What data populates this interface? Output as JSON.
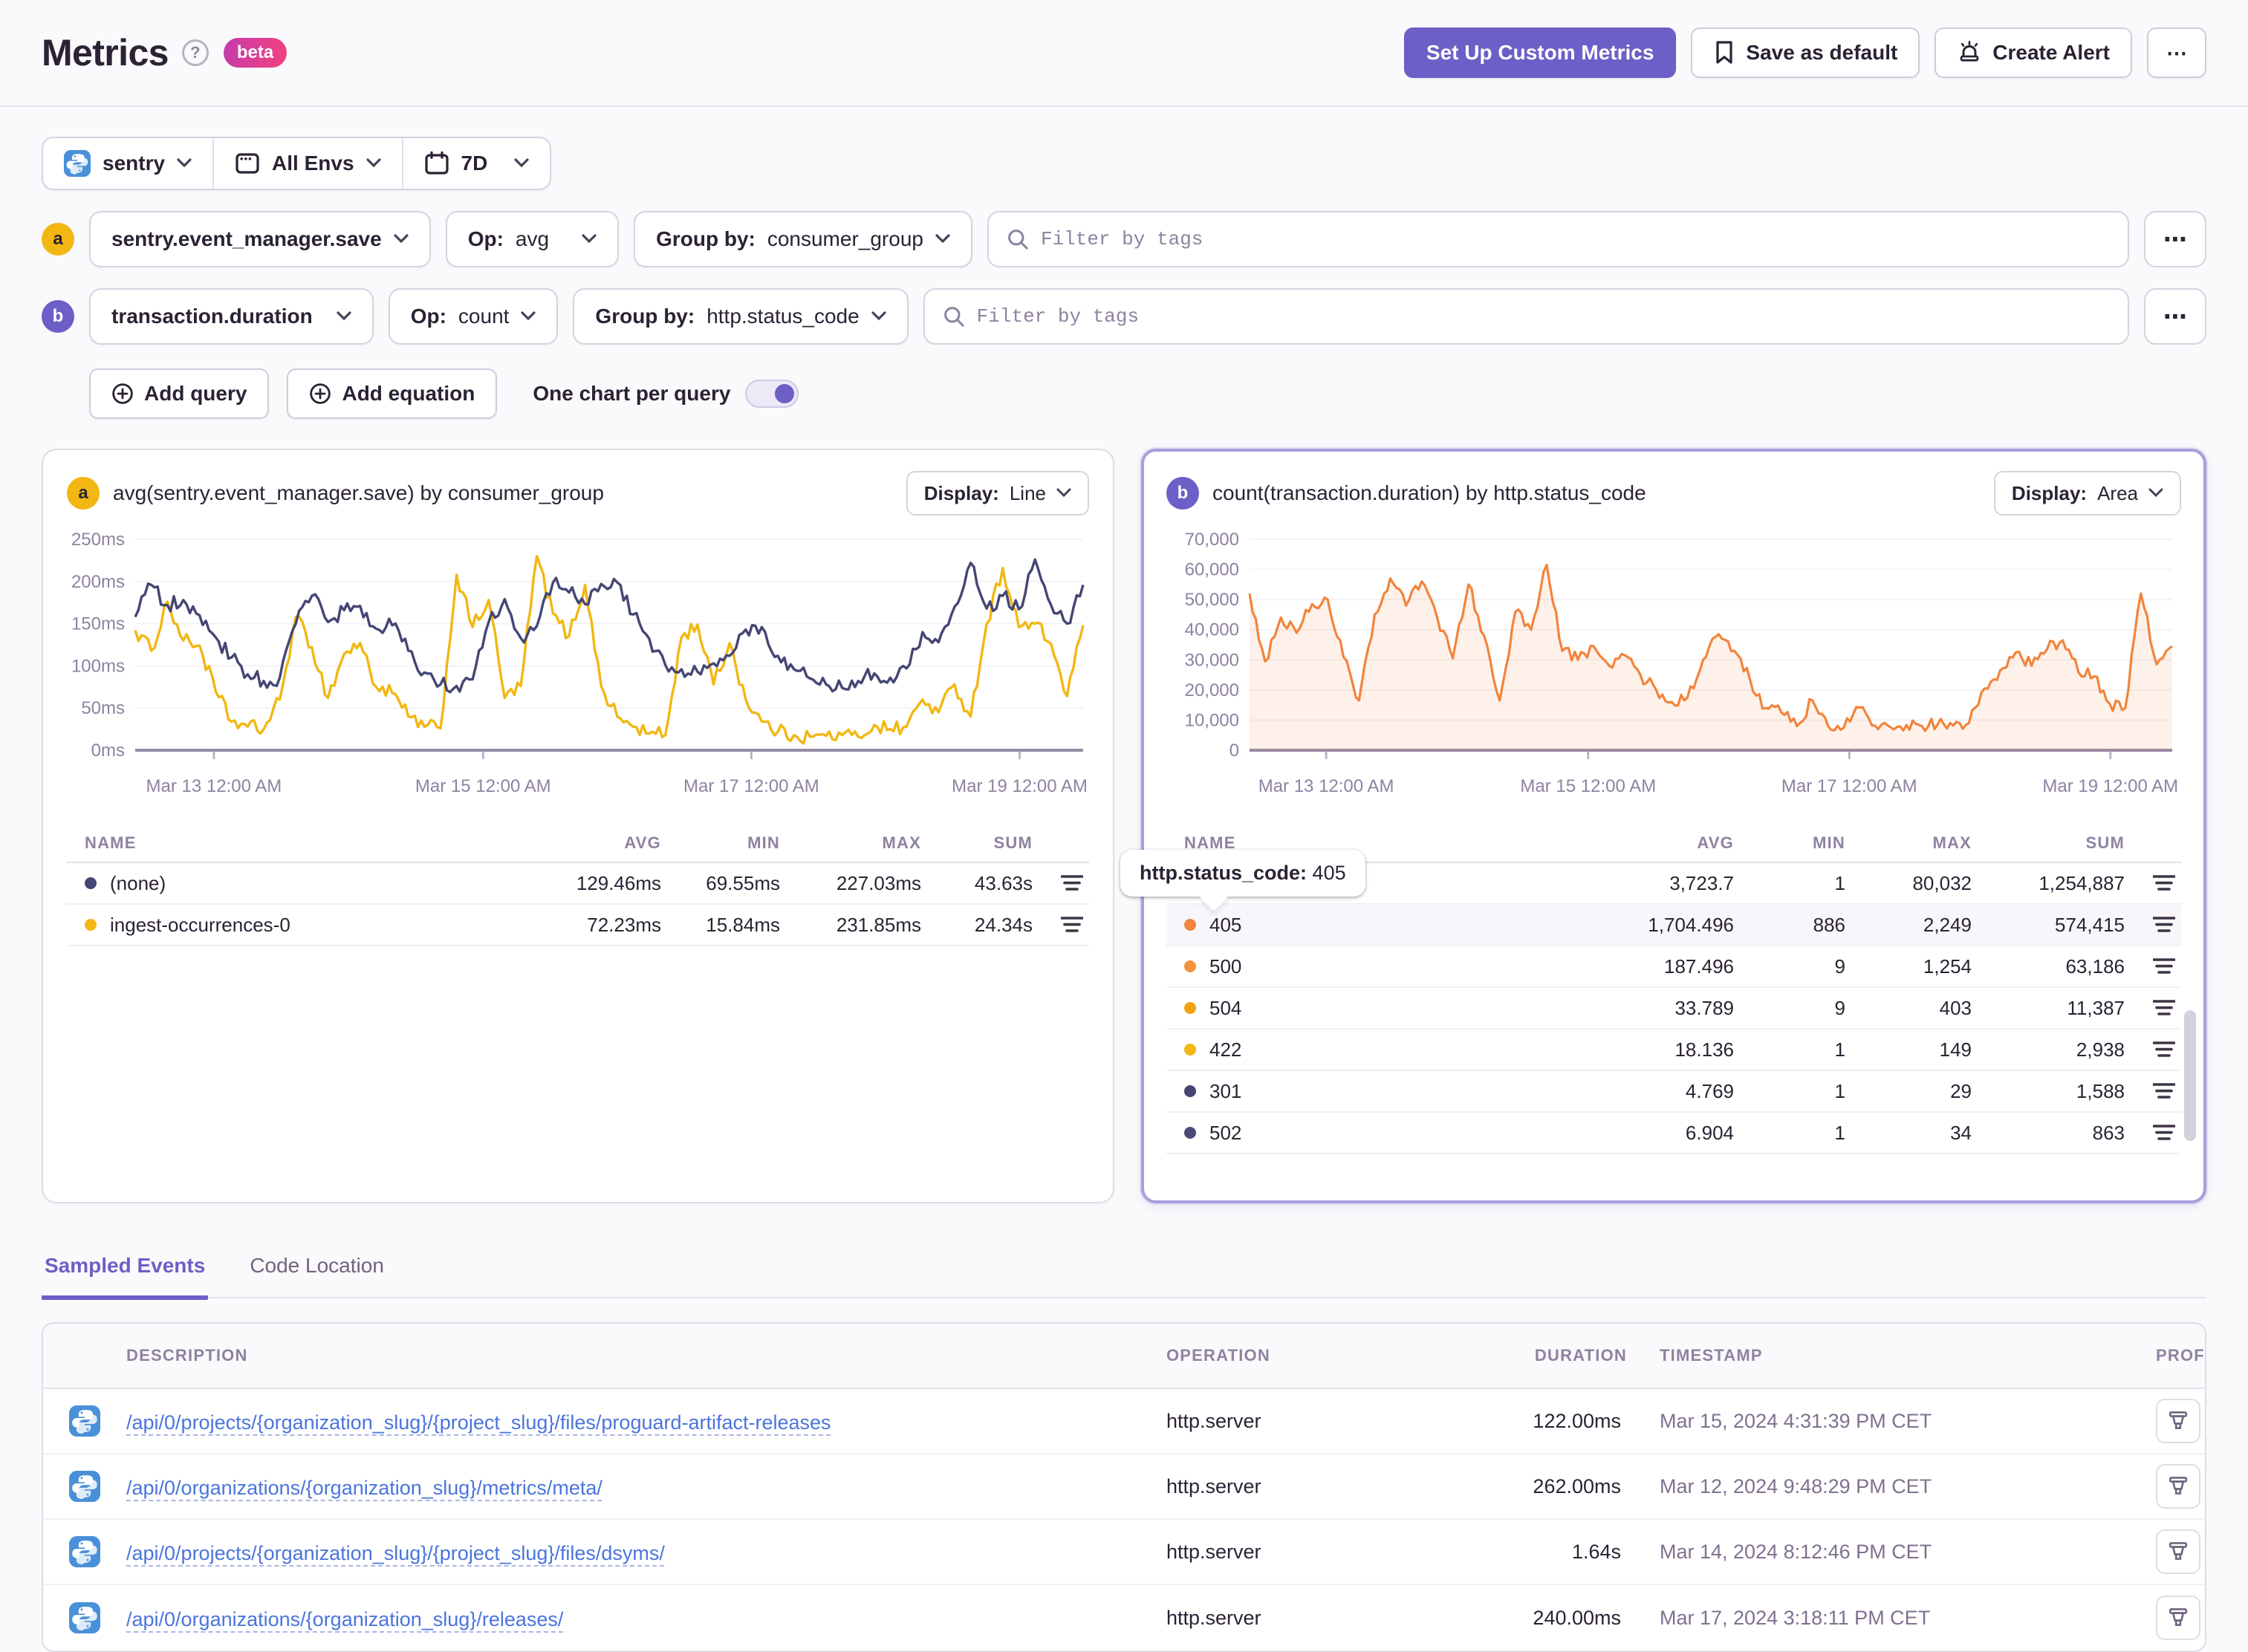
{
  "header": {
    "title": "Metrics",
    "help": "?",
    "beta": "beta",
    "setup_button": "Set Up Custom Metrics",
    "save_default_button": "Save as default",
    "create_alert_button": "Create Alert",
    "more_button": "⋯"
  },
  "filter_bar": {
    "project": "sentry",
    "environment": "All Envs",
    "date_range": "7D"
  },
  "query_builder": {
    "op_label": "Op:",
    "groupby_label": "Group by:",
    "filter_placeholder": "Filter by tags",
    "more_button": "⋯",
    "queries": [
      {
        "letter": "a",
        "metric": "sentry.event_manager.save",
        "op": "avg",
        "group_by": "consumer_group"
      },
      {
        "letter": "b",
        "metric": "transaction.duration",
        "op": "count",
        "group_by": "http.status_code"
      }
    ],
    "add_query": "Add query",
    "add_equation": "Add equation",
    "one_chart_per_query": "One chart per query",
    "toggle_on": true
  },
  "display_label": "Display:",
  "legend_columns": [
    "NAME",
    "AVG",
    "MIN",
    "MAX",
    "SUM"
  ],
  "tooltip": {
    "label": "http.status_code:",
    "value": "405"
  },
  "chart_data": [
    {
      "type": "line",
      "query_letter": "a",
      "title": "avg(sentry.event_manager.save) by consumer_group",
      "display_mode": "Line",
      "ylim": [
        0,
        250
      ],
      "yticks": [
        {
          "v": 0,
          "label": "0ms"
        },
        {
          "v": 50,
          "label": "50ms"
        },
        {
          "v": 100,
          "label": "100ms"
        },
        {
          "v": 150,
          "label": "150ms"
        },
        {
          "v": 200,
          "label": "200ms"
        },
        {
          "v": 250,
          "label": "250ms"
        }
      ],
      "xticks": [
        {
          "f": 0.083,
          "label": "Mar 13 12:00 AM"
        },
        {
          "f": 0.367,
          "label": "Mar 15 12:00 AM"
        },
        {
          "f": 0.65,
          "label": "Mar 17 12:00 AM"
        },
        {
          "f": 0.933,
          "label": "Mar 19 12:00 AM"
        }
      ],
      "noise": 9,
      "series": [
        {
          "name": "ingest-occurrences-0",
          "color": "#F2B712",
          "values": [
            142,
            118,
            176,
            130,
            124,
            70,
            34,
            28,
            25,
            60,
            158,
            122,
            62,
            114,
            127,
            75,
            68,
            40,
            28,
            26,
            208,
            146,
            178,
            62,
            76,
            230,
            162,
            135,
            196,
            76,
            40,
            28,
            20,
            18,
            134,
            149,
            78,
            127,
            60,
            34,
            22,
            18,
            16,
            17,
            18,
            16,
            30,
            25,
            28,
            60,
            45,
            78,
            40,
            150,
            216,
            146,
            150,
            126,
            64,
            148
          ]
        },
        {
          "name": "(none)",
          "color": "#444674",
          "values": [
            158,
            196,
            172,
            178,
            160,
            134,
            110,
            90,
            82,
            86,
            150,
            183,
            152,
            166,
            171,
            144,
            148,
            118,
            92,
            78,
            76,
            84,
            152,
            179,
            133,
            147,
            199,
            187,
            173,
            197,
            199,
            161,
            132,
            101,
            96,
            93,
            103,
            112,
            143,
            146,
            112,
            96,
            85,
            78,
            74,
            82,
            91,
            86,
            97,
            140,
            128,
            170,
            222,
            168,
            183,
            167,
            226,
            172,
            150,
            196
          ]
        }
      ],
      "legend_rows": [
        {
          "name": "(none)",
          "color": "#444674",
          "avg": "129.46ms",
          "min": "69.55ms",
          "max": "227.03ms",
          "sum": "43.63s"
        },
        {
          "name": "ingest-occurrences-0",
          "color": "#F2B712",
          "avg": "72.23ms",
          "min": "15.84ms",
          "max": "231.85ms",
          "sum": "24.34s"
        }
      ]
    },
    {
      "type": "area",
      "query_letter": "b",
      "title": "count(transaction.duration) by http.status_code",
      "display_mode": "Area",
      "ylim": [
        0,
        70000
      ],
      "yticks": [
        {
          "v": 0,
          "label": "0"
        },
        {
          "v": 10000,
          "label": "10,000"
        },
        {
          "v": 20000,
          "label": "20,000"
        },
        {
          "v": 30000,
          "label": "30,000"
        },
        {
          "v": 40000,
          "label": "40,000"
        },
        {
          "v": 50000,
          "label": "50,000"
        },
        {
          "v": 60000,
          "label": "60,000"
        },
        {
          "v": 70000,
          "label": "70,000"
        }
      ],
      "xticks": [
        {
          "f": 0.083,
          "label": "Mar 13 12:00 AM"
        },
        {
          "f": 0.367,
          "label": "Mar 15 12:00 AM"
        },
        {
          "f": 0.65,
          "label": "Mar 17 12:00 AM"
        },
        {
          "f": 0.933,
          "label": "Mar 19 12:00 AM"
        }
      ],
      "noise": 2200,
      "series": [
        {
          "name": "405",
          "color": "#F2843B",
          "fill": "rgba(242,132,59,0.11)",
          "values": [
            52000,
            29500,
            44000,
            39000,
            48500,
            50000,
            31000,
            16500,
            45000,
            57000,
            48000,
            56000,
            44000,
            30500,
            55000,
            38000,
            16500,
            46000,
            40000,
            61500,
            33000,
            30000,
            34500,
            28000,
            31500,
            25000,
            20000,
            16000,
            17500,
            30000,
            38500,
            33000,
            23500,
            14000,
            12500,
            8000,
            16500,
            8000,
            7500,
            14200,
            8200,
            7600,
            8400,
            8000,
            8600,
            8200,
            9000,
            20500,
            26500,
            32500,
            28000,
            33500,
            36500,
            26000,
            24500,
            15500,
            14000,
            52000,
            28500,
            34500
          ]
        }
      ],
      "legend_rows": [
        {
          "name": "",
          "color": "",
          "avg": "3,723.7",
          "min": "1",
          "max": "80,032",
          "sum": "1,254,887"
        },
        {
          "name": "405",
          "color": "#F2843B",
          "avg": "1,704.496",
          "min": "886",
          "max": "2,249",
          "sum": "574,415",
          "highlight": true
        },
        {
          "name": "500",
          "color": "#F2933E",
          "avg": "187.496",
          "min": "9",
          "max": "1,254",
          "sum": "63,186"
        },
        {
          "name": "504",
          "color": "#F2A20C",
          "avg": "33.789",
          "min": "9",
          "max": "403",
          "sum": "11,387"
        },
        {
          "name": "422",
          "color": "#F2B712",
          "avg": "18.136",
          "min": "1",
          "max": "149",
          "sum": "2,938"
        },
        {
          "name": "301",
          "color": "#444674",
          "avg": "4.769",
          "min": "1",
          "max": "29",
          "sum": "1,588"
        },
        {
          "name": "502",
          "color": "#4E4A77",
          "avg": "6.904",
          "min": "1",
          "max": "34",
          "sum": "863"
        }
      ]
    }
  ],
  "tabs": [
    {
      "label": "Sampled Events",
      "active": true
    },
    {
      "label": "Code Location",
      "active": false
    }
  ],
  "events_table": {
    "columns": [
      "DESCRIPTION",
      "OPERATION",
      "DURATION",
      "TIMESTAMP",
      "PROFILE"
    ],
    "rows": [
      {
        "description": "/api/0/projects/{organization_slug}/{project_slug}/files/proguard-artifact-releases",
        "operation": "http.server",
        "duration": "122.00ms",
        "timestamp": "Mar 15, 2024 4:31:39 PM CET"
      },
      {
        "description": "/api/0/organizations/{organization_slug}/metrics/meta/",
        "operation": "http.server",
        "duration": "262.00ms",
        "timestamp": "Mar 12, 2024 9:48:29 PM CET"
      },
      {
        "description": "/api/0/projects/{organization_slug}/{project_slug}/files/dsyms/",
        "operation": "http.server",
        "duration": "1.64s",
        "timestamp": "Mar 14, 2024 8:12:46 PM CET"
      },
      {
        "description": "/api/0/organizations/{organization_slug}/releases/",
        "operation": "http.server",
        "duration": "240.00ms",
        "timestamp": "Mar 17, 2024 3:18:11 PM CET"
      }
    ]
  },
  "colors": {
    "accent": "#6C5FC7",
    "navy": "#444674",
    "yellow": "#F2B712",
    "orange": "#F2843B",
    "link": "#4B74DC",
    "selected_border": "#A79FDB",
    "axis_text": "#8E82A0"
  }
}
